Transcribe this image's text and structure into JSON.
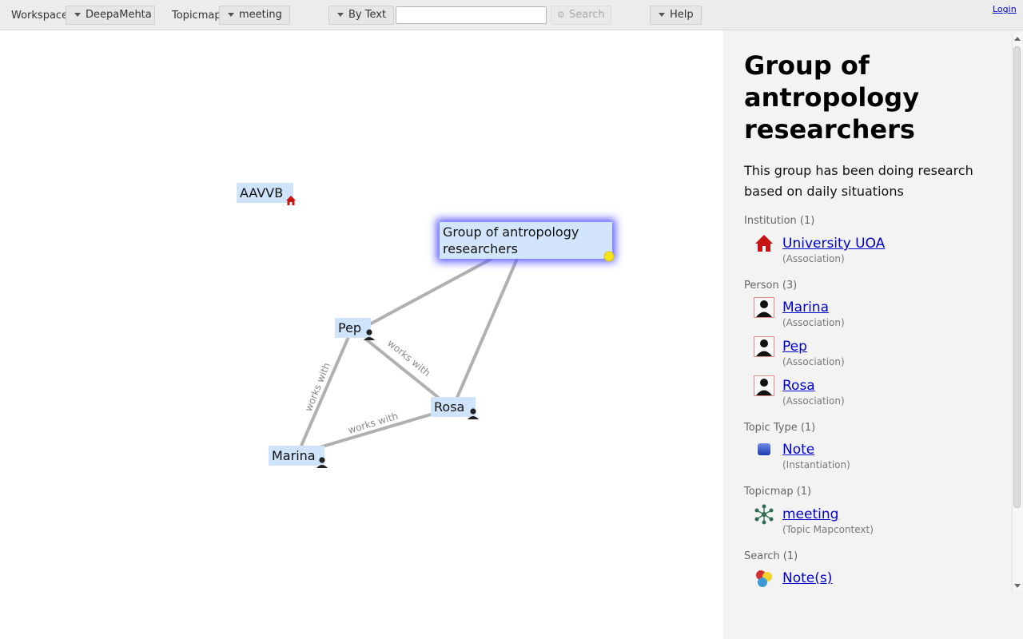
{
  "toolbar": {
    "workspace_label": "Workspace",
    "workspace_value": "DeepaMehta",
    "topicmap_label": "Topicmap",
    "topicmap_value": "meeting",
    "search_mode": "By Text",
    "search_placeholder": "",
    "search_button": "Search",
    "help_button": "Help",
    "login_link": "Login"
  },
  "canvas": {
    "topics": [
      {
        "label": "AAVVB",
        "icon": "institution-icon"
      },
      {
        "label": "Group of antropology researchers",
        "icon": "note-icon",
        "selected": true
      },
      {
        "label": "Pep",
        "icon": "person-icon"
      },
      {
        "label": "Rosa",
        "icon": "person-icon"
      },
      {
        "label": "Marina",
        "icon": "person-icon"
      }
    ],
    "edge_labels": [
      "works with",
      "works with",
      "works with"
    ]
  },
  "detail": {
    "title": "Group of antropology researchers",
    "description": "This group has been doing research based on daily situations",
    "sections": [
      {
        "heading": "Institution (1)",
        "items": [
          {
            "name": "University UOA",
            "type": "(Association)",
            "icon": "institution-icon"
          }
        ]
      },
      {
        "heading": "Person (3)",
        "items": [
          {
            "name": "Marina",
            "type": "(Association)",
            "icon": "person-icon"
          },
          {
            "name": "Pep",
            "type": "(Association)",
            "icon": "person-icon"
          },
          {
            "name": "Rosa",
            "type": "(Association)",
            "icon": "person-icon"
          }
        ]
      },
      {
        "heading": "Topic Type (1)",
        "items": [
          {
            "name": "Note",
            "type": "(Instantiation)",
            "icon": "note-icon"
          }
        ]
      },
      {
        "heading": "Topicmap (1)",
        "items": [
          {
            "name": "meeting",
            "type": "(Topic Mapcontext)",
            "icon": "topicmap-icon"
          }
        ]
      },
      {
        "heading": "Search (1)",
        "items": [
          {
            "name": "Note(s)",
            "type": "",
            "icon": "search-result-icon"
          }
        ]
      }
    ]
  },
  "colors": {
    "topic_bg": "#cfe3fb",
    "selection_glow": "#5d5dff",
    "edge": "#b0b0b0",
    "link": "#0000cc"
  }
}
